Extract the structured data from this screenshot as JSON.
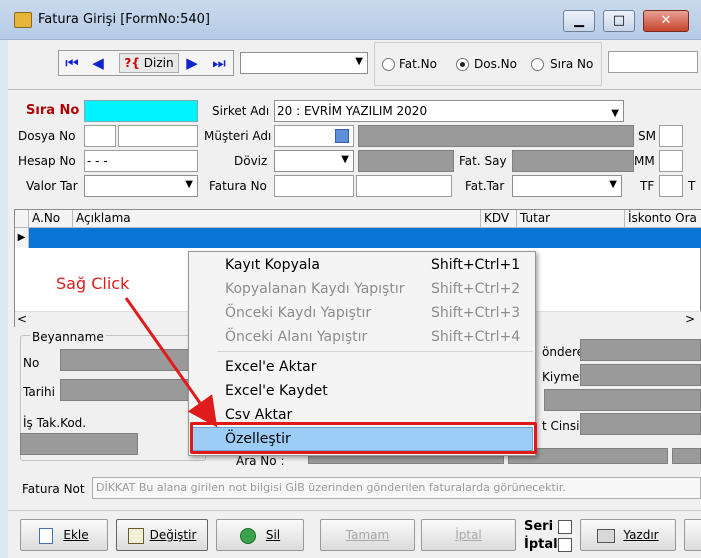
{
  "window": {
    "title": "Fatura Girişi [FormNo:540]",
    "minimize": "▁",
    "maximize": "□",
    "close": "✕"
  },
  "toolbar": {
    "first": "⏮",
    "prev": "◀",
    "dizin_q": "?{",
    "dizin_label": "Dizin",
    "next": "▶",
    "last": "⏭",
    "combo_value": "",
    "radios": [
      {
        "label": "Fat.No",
        "selected": false
      },
      {
        "label": "Dos.No",
        "selected": true
      },
      {
        "label": "Sıra No",
        "selected": false
      }
    ],
    "search_value": ""
  },
  "form": {
    "sira_no_label": "Sıra No",
    "sira_no_value": "",
    "sirket_label": "Sirket Adı",
    "sirket_value": "20 : EVRİM YAZILIM  2020",
    "dosya_label": "Dosya No",
    "musteri_label": "Müşteri Adı",
    "sm_label": "SM",
    "hesap_label": "Hesap No",
    "hesap_value": " -  -  -",
    "doviz_label": "Döviz",
    "fatsay_label": "Fat. Say",
    "mm_label": "MM",
    "valor_label": "Valor Tar",
    "faturano_label": "Fatura No",
    "fattar_label": "Fat.Tar",
    "tf_label": "TF",
    "t_label": "T"
  },
  "grid": {
    "columns": [
      "A.No",
      "Açıklama",
      "KDV",
      "Tutar",
      "İskonto Ora"
    ],
    "row_indicator": "▶",
    "scroll_left": "<",
    "scroll_right": ">"
  },
  "lower": {
    "beyanname_label": "Beyanname",
    "no_label": "No",
    "tarihi_label": "Tarihi",
    "istak_label": "İş Tak.Kod.",
    "gonderen_label": "önderen",
    "kiymet_label": "Kiymet",
    "cinsi_label": "t Cinsi",
    "arano_label": "Ara No :"
  },
  "notes": {
    "label": "Fatura Not",
    "value": "DİKKAT Bu alana girilen not bilgisi GİB üzerinden gönderilen faturalarda görünecektir."
  },
  "buttons": {
    "ekle": "Ekle",
    "degistir": "Değiştir",
    "sil": "Sil",
    "tamam": "Tamam",
    "iptal": "İptal",
    "seri": "Seri",
    "iptal_chk": "İptal",
    "yazdir": "Yazdır"
  },
  "context_menu": {
    "items": [
      {
        "label": "Kayıt Kopyala",
        "shortcut": "Shift+Ctrl+1",
        "enabled": true
      },
      {
        "label": "Kopyalanan Kaydı Yapıştır",
        "shortcut": "Shift+Ctrl+2",
        "enabled": false
      },
      {
        "label": "Önceki Kaydı Yapıştır",
        "shortcut": "Shift+Ctrl+3",
        "enabled": false
      },
      {
        "label": "Önceki Alanı Yapıştır",
        "shortcut": "Shift+Ctrl+4",
        "enabled": false
      },
      {
        "label": "Excel'e Aktar",
        "shortcut": "",
        "enabled": true
      },
      {
        "label": "Excel'e Kaydet",
        "shortcut": "",
        "enabled": true
      },
      {
        "label": "Csv Aktar",
        "shortcut": "",
        "enabled": true
      },
      {
        "label": "Özelleştir",
        "shortcut": "",
        "enabled": true,
        "highlighted": true
      }
    ]
  },
  "annotation": {
    "text": "Sağ Click",
    "color": "#e01b1b"
  }
}
